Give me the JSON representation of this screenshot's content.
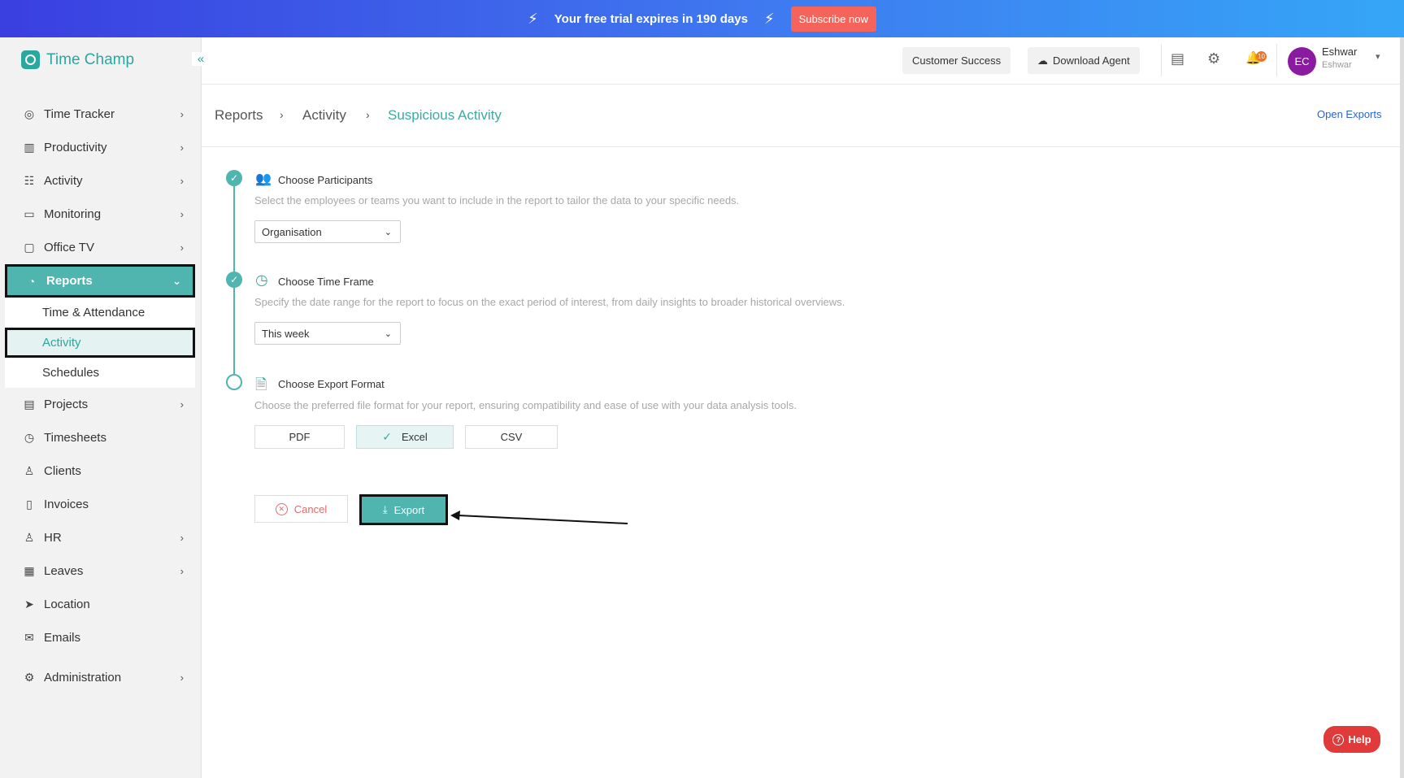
{
  "banner": {
    "trial_text": "Your free trial expires in 190 days",
    "subscribe_label": "Subscribe now",
    "bolt_glyph": "⚡"
  },
  "app": {
    "name": "Time Champ",
    "collapse_glyph": "«"
  },
  "sidebar": {
    "items": [
      {
        "label": "Time Tracker",
        "icon": "target-icon",
        "glyph": "◎",
        "chevron": "›"
      },
      {
        "label": "Productivity",
        "icon": "bar-chart-icon",
        "glyph": "▥",
        "chevron": "›"
      },
      {
        "label": "Activity",
        "icon": "activity-icon",
        "glyph": "☷",
        "chevron": "›"
      },
      {
        "label": "Monitoring",
        "icon": "monitor-icon",
        "glyph": "▭",
        "chevron": "›"
      },
      {
        "label": "Office TV",
        "icon": "tv-icon",
        "glyph": "▢",
        "chevron": "›"
      },
      {
        "label": "Reports",
        "icon": "pie-chart-icon",
        "glyph": "◔",
        "chevron": "⌄"
      },
      {
        "label": "Projects",
        "icon": "briefcase-icon",
        "glyph": "▤",
        "chevron": "›"
      },
      {
        "label": "Timesheets",
        "icon": "clock-icon",
        "glyph": "◷"
      },
      {
        "label": "Clients",
        "icon": "user-icon",
        "glyph": "♙"
      },
      {
        "label": "Invoices",
        "icon": "invoice-icon",
        "glyph": "▯"
      },
      {
        "label": "HR",
        "icon": "person-icon",
        "glyph": "♙",
        "chevron": "›"
      },
      {
        "label": "Leaves",
        "icon": "calendar-icon",
        "glyph": "▦",
        "chevron": "›"
      },
      {
        "label": "Location",
        "icon": "location-arrow-icon",
        "glyph": "➤"
      },
      {
        "label": "Emails",
        "icon": "mail-icon",
        "glyph": "✉"
      },
      {
        "label": "Administration",
        "icon": "settings-icon",
        "glyph": "⚙",
        "chevron": "›"
      }
    ],
    "reports_sub": [
      "Time & Attendance",
      "Activity",
      "Schedules"
    ]
  },
  "header": {
    "customer_success": "Customer Success",
    "download_agent": "Download Agent",
    "cloud_glyph": "☁",
    "doc_glyph": "▤",
    "gear_glyph": "⚙",
    "bell_glyph": "🔔",
    "notification_count": "10",
    "avatar_initials": "EC",
    "user_name": "Eshwar",
    "user_sub": "Eshwar",
    "caret_glyph": "▾"
  },
  "breadcrumb": {
    "items": [
      "Reports",
      "Activity",
      "Suspicious Activity"
    ],
    "separator": "›",
    "open_exports": "Open Exports"
  },
  "steps": {
    "check_glyph": "✓",
    "participants": {
      "title": "Choose Participants",
      "icon_glyph": "👥",
      "desc": "Select the employees or teams you want to include in the report to tailor the data to your specific needs.",
      "value": "Organisation"
    },
    "timeframe": {
      "title": "Choose Time Frame",
      "icon_glyph": "◷",
      "desc": "Specify the date range for the report to focus on the exact period of interest, from daily insights to broader historical overviews.",
      "value": "This week"
    },
    "format": {
      "title": "Choose Export Format",
      "icon_glyph": "🗎",
      "desc": "Choose the preferred file format for your report, ensuring compatibility and ease of use with your data analysis tools.",
      "options": [
        "PDF",
        "Excel",
        "CSV"
      ],
      "selected": "Excel"
    },
    "select_caret": "⌄"
  },
  "actions": {
    "cancel": "Cancel",
    "export": "Export",
    "cancel_glyph": "✕",
    "export_glyph": "⤓"
  },
  "help": {
    "label": "Help",
    "glyph": "?"
  },
  "colors": {
    "accent": "#4fb5ae",
    "banner": "#3f6ee8",
    "subscribe": "#f5645a",
    "help": "#e03a3a",
    "avatar": "#8a1aa0"
  }
}
